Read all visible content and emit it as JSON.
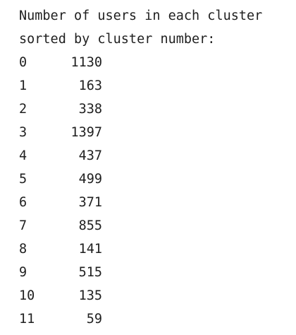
{
  "output": {
    "header_line_1": "Number of users in each cluster",
    "header_line_2": "sorted by cluster number:",
    "rows": [
      {
        "cluster": "0",
        "count": "1130"
      },
      {
        "cluster": "1",
        "count": "163"
      },
      {
        "cluster": "2",
        "count": "338"
      },
      {
        "cluster": "3",
        "count": "1397"
      },
      {
        "cluster": "4",
        "count": "437"
      },
      {
        "cluster": "5",
        "count": "499"
      },
      {
        "cluster": "6",
        "count": "371"
      },
      {
        "cluster": "7",
        "count": "855"
      },
      {
        "cluster": "8",
        "count": "141"
      },
      {
        "cluster": "9",
        "count": "515"
      },
      {
        "cluster": "10",
        "count": "135"
      },
      {
        "cluster": "11",
        "count": "59"
      }
    ]
  }
}
